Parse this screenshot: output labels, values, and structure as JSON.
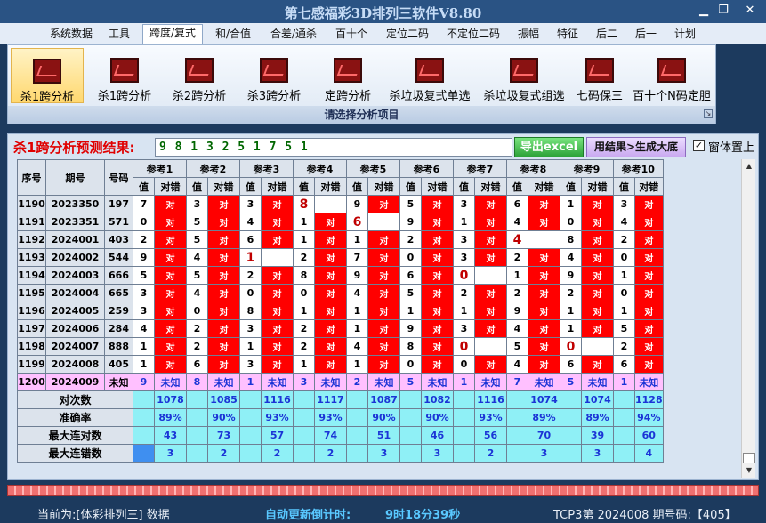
{
  "app": {
    "title": "第七感福彩3D排列三软件V8.80",
    "min_icon": "minimize-icon",
    "restore_icon": "restore-icon",
    "close_icon": "close-icon"
  },
  "menu": [
    {
      "label": "系统数据"
    },
    {
      "label": "工具"
    },
    {
      "label": "跨度/复式",
      "active": true
    },
    {
      "label": "和/合值"
    },
    {
      "label": "合差/通杀"
    },
    {
      "label": "百十个"
    },
    {
      "label": "定位二码"
    },
    {
      "label": "不定位二码"
    },
    {
      "label": "振幅"
    },
    {
      "label": "特征"
    },
    {
      "label": "后二"
    },
    {
      "label": "后一"
    },
    {
      "label": "计划"
    }
  ],
  "ribbon": {
    "buttons": [
      {
        "label": "杀1跨分析",
        "active": true
      },
      {
        "label": "杀1跨分析"
      },
      {
        "label": "杀2跨分析"
      },
      {
        "label": "杀3跨分析"
      },
      {
        "label": "定跨分析"
      },
      {
        "label": "杀垃圾复式单选"
      },
      {
        "label": "杀垃圾复式组选"
      },
      {
        "label": "七码保三"
      },
      {
        "label": "百十个N码定胆"
      }
    ],
    "caption": "请选择分析项目",
    "icon": "chart-icon"
  },
  "prediction": {
    "label": "杀1跨分析预测结果:",
    "value": "9 8 1 3 2 5 1 7 5 1",
    "export_label": "导出excel",
    "generate_label": "用结果>生成大底",
    "topmost_label": "窗体置上",
    "topmost_checked": "✓"
  },
  "grid": {
    "headers": {
      "idx": "序号",
      "issue": "期号",
      "code": "号码",
      "val": "值",
      "mark": "对错"
    },
    "refs": [
      "参考1",
      "参考2",
      "参考3",
      "参考4",
      "参考5",
      "参考6",
      "参考7",
      "参考8",
      "参考9",
      "参考10"
    ],
    "ok_text": "对",
    "unknown_text": "未知",
    "rows": [
      {
        "idx": "1190",
        "issue": "2023350",
        "code": "197",
        "cells": [
          [
            "7",
            "ok"
          ],
          [
            "3",
            "ok"
          ],
          [
            "3",
            "ok"
          ],
          [
            "8",
            "miss"
          ],
          [
            "9",
            "ok"
          ],
          [
            "5",
            "ok"
          ],
          [
            "3",
            "ok"
          ],
          [
            "6",
            "ok"
          ],
          [
            "1",
            "ok"
          ],
          [
            "3",
            "ok"
          ]
        ]
      },
      {
        "idx": "1191",
        "issue": "2023351",
        "code": "571",
        "cells": [
          [
            "0",
            "ok"
          ],
          [
            "5",
            "ok"
          ],
          [
            "4",
            "ok"
          ],
          [
            "1",
            "ok"
          ],
          [
            "6",
            "miss"
          ],
          [
            "9",
            "ok"
          ],
          [
            "1",
            "ok"
          ],
          [
            "4",
            "ok"
          ],
          [
            "0",
            "ok"
          ],
          [
            "4",
            "ok"
          ]
        ]
      },
      {
        "idx": "1192",
        "issue": "2024001",
        "code": "403",
        "cells": [
          [
            "2",
            "ok"
          ],
          [
            "5",
            "ok"
          ],
          [
            "6",
            "ok"
          ],
          [
            "1",
            "ok"
          ],
          [
            "1",
            "ok"
          ],
          [
            "2",
            "ok"
          ],
          [
            "3",
            "ok"
          ],
          [
            "4",
            "miss"
          ],
          [
            "8",
            "ok"
          ],
          [
            "2",
            "ok"
          ]
        ]
      },
      {
        "idx": "1193",
        "issue": "2024002",
        "code": "544",
        "cells": [
          [
            "9",
            "ok"
          ],
          [
            "4",
            "ok"
          ],
          [
            "1",
            "miss"
          ],
          [
            "2",
            "ok"
          ],
          [
            "7",
            "ok"
          ],
          [
            "0",
            "ok"
          ],
          [
            "3",
            "ok"
          ],
          [
            "2",
            "ok"
          ],
          [
            "4",
            "ok"
          ],
          [
            "0",
            "ok"
          ]
        ]
      },
      {
        "idx": "1194",
        "issue": "2024003",
        "code": "666",
        "cells": [
          [
            "5",
            "ok"
          ],
          [
            "5",
            "ok"
          ],
          [
            "2",
            "ok"
          ],
          [
            "8",
            "ok"
          ],
          [
            "9",
            "ok"
          ],
          [
            "6",
            "ok"
          ],
          [
            "0",
            "miss"
          ],
          [
            "1",
            "ok"
          ],
          [
            "9",
            "ok"
          ],
          [
            "1",
            "ok"
          ]
        ]
      },
      {
        "idx": "1195",
        "issue": "2024004",
        "code": "665",
        "cells": [
          [
            "3",
            "ok"
          ],
          [
            "4",
            "ok"
          ],
          [
            "0",
            "ok"
          ],
          [
            "0",
            "ok"
          ],
          [
            "4",
            "ok"
          ],
          [
            "5",
            "ok"
          ],
          [
            "2",
            "ok"
          ],
          [
            "2",
            "ok"
          ],
          [
            "2",
            "ok"
          ],
          [
            "0",
            "ok"
          ]
        ]
      },
      {
        "idx": "1196",
        "issue": "2024005",
        "code": "259",
        "cells": [
          [
            "3",
            "ok"
          ],
          [
            "0",
            "ok"
          ],
          [
            "8",
            "ok"
          ],
          [
            "1",
            "ok"
          ],
          [
            "1",
            "ok"
          ],
          [
            "1",
            "ok"
          ],
          [
            "1",
            "ok"
          ],
          [
            "9",
            "ok"
          ],
          [
            "1",
            "ok"
          ],
          [
            "1",
            "ok"
          ]
        ]
      },
      {
        "idx": "1197",
        "issue": "2024006",
        "code": "284",
        "cells": [
          [
            "4",
            "ok"
          ],
          [
            "2",
            "ok"
          ],
          [
            "3",
            "ok"
          ],
          [
            "2",
            "ok"
          ],
          [
            "1",
            "ok"
          ],
          [
            "9",
            "ok"
          ],
          [
            "3",
            "ok"
          ],
          [
            "4",
            "ok"
          ],
          [
            "1",
            "ok"
          ],
          [
            "5",
            "ok"
          ]
        ]
      },
      {
        "idx": "1198",
        "issue": "2024007",
        "code": "888",
        "cells": [
          [
            "1",
            "ok"
          ],
          [
            "2",
            "ok"
          ],
          [
            "1",
            "ok"
          ],
          [
            "2",
            "ok"
          ],
          [
            "4",
            "ok"
          ],
          [
            "8",
            "ok"
          ],
          [
            "0",
            "miss"
          ],
          [
            "5",
            "ok"
          ],
          [
            "0",
            "miss"
          ],
          [
            "2",
            "ok"
          ]
        ]
      },
      {
        "idx": "1199",
        "issue": "2024008",
        "code": "405",
        "cells": [
          [
            "1",
            "ok"
          ],
          [
            "6",
            "ok"
          ],
          [
            "3",
            "ok"
          ],
          [
            "1",
            "ok"
          ],
          [
            "1",
            "ok"
          ],
          [
            "0",
            "ok"
          ],
          [
            "0",
            "ok"
          ],
          [
            "4",
            "ok"
          ],
          [
            "6",
            "ok"
          ],
          [
            "6",
            "ok"
          ]
        ]
      }
    ],
    "last_row": {
      "idx": "1200",
      "issue": "2024009",
      "code": "未知",
      "values": [
        "9",
        "8",
        "1",
        "3",
        "2",
        "5",
        "1",
        "7",
        "5",
        "1"
      ]
    },
    "stats": [
      {
        "label": "对次数",
        "values": [
          "1078",
          "1085",
          "1116",
          "1117",
          "1087",
          "1082",
          "1116",
          "1074",
          "1074",
          "1128"
        ]
      },
      {
        "label": "准确率",
        "values": [
          "89%",
          "90%",
          "93%",
          "93%",
          "90%",
          "90%",
          "93%",
          "89%",
          "89%",
          "94%"
        ]
      },
      {
        "label": "最大连对数",
        "values": [
          "43",
          "73",
          "57",
          "74",
          "51",
          "46",
          "56",
          "70",
          "39",
          "60"
        ]
      },
      {
        "label": "最大连错数",
        "values": [
          "3",
          "2",
          "2",
          "2",
          "3",
          "3",
          "2",
          "3",
          "3",
          "4"
        ]
      }
    ]
  },
  "status": {
    "current_label": "当前为:[体彩排列三] 数据",
    "countdown_label": "自动更新倒计时:",
    "countdown_value": "9时18分39秒",
    "issue_info": "TCP3第 2024008 期号码:【405】"
  },
  "colors": {
    "ok_bg": "#ff0000",
    "unknown_bg": "#ffc0ff",
    "stat_bg": "#8ff0f6",
    "title_bar": "#2a5384"
  }
}
